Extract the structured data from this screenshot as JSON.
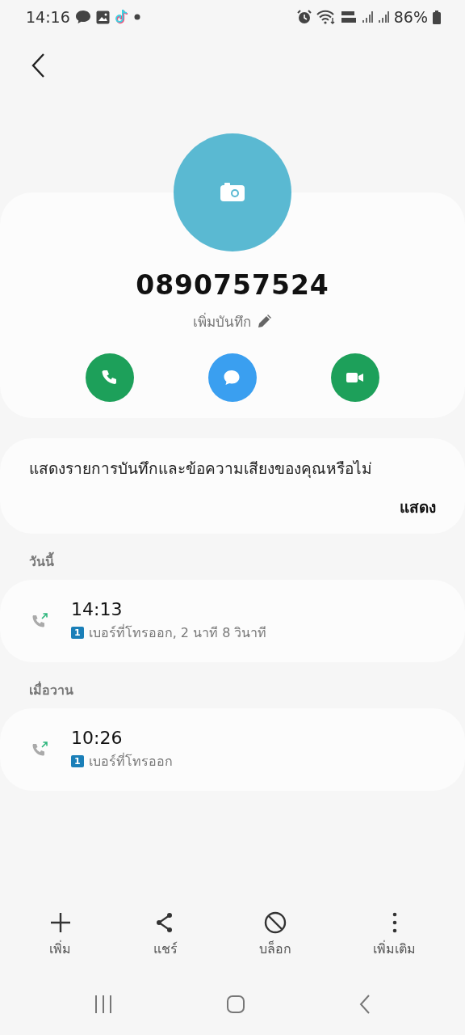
{
  "status_bar": {
    "time": "14:16",
    "battery": "86%"
  },
  "contact": {
    "number": "0890757524",
    "note_label": "เพิ่มบันทึก",
    "actions": [
      {
        "kind": "call"
      },
      {
        "kind": "message"
      },
      {
        "kind": "video"
      }
    ]
  },
  "recording_prompt": {
    "text": "แสดงรายการบันทึกและข้อความเสียงของคุณหรือไม่",
    "button": "แสดง"
  },
  "call_log": [
    {
      "heading": "วันนี้",
      "calls": [
        {
          "kind": "outgoing",
          "time": "14:13",
          "sim": "1",
          "detail": "เบอร์ที่โทรออก, 2 นาที 8 วินาที"
        }
      ]
    },
    {
      "heading": "เมื่อวาน",
      "calls": [
        {
          "kind": "outgoing",
          "time": "10:26",
          "sim": "1",
          "detail": "เบอร์ที่โทรออก"
        }
      ]
    }
  ],
  "bottom_actions": [
    {
      "kind": "add",
      "label": "เพิ่ม"
    },
    {
      "kind": "share",
      "label": "แชร์"
    },
    {
      "kind": "block",
      "label": "บล็อก"
    },
    {
      "kind": "more",
      "label": "เพิ่มเติม"
    }
  ]
}
